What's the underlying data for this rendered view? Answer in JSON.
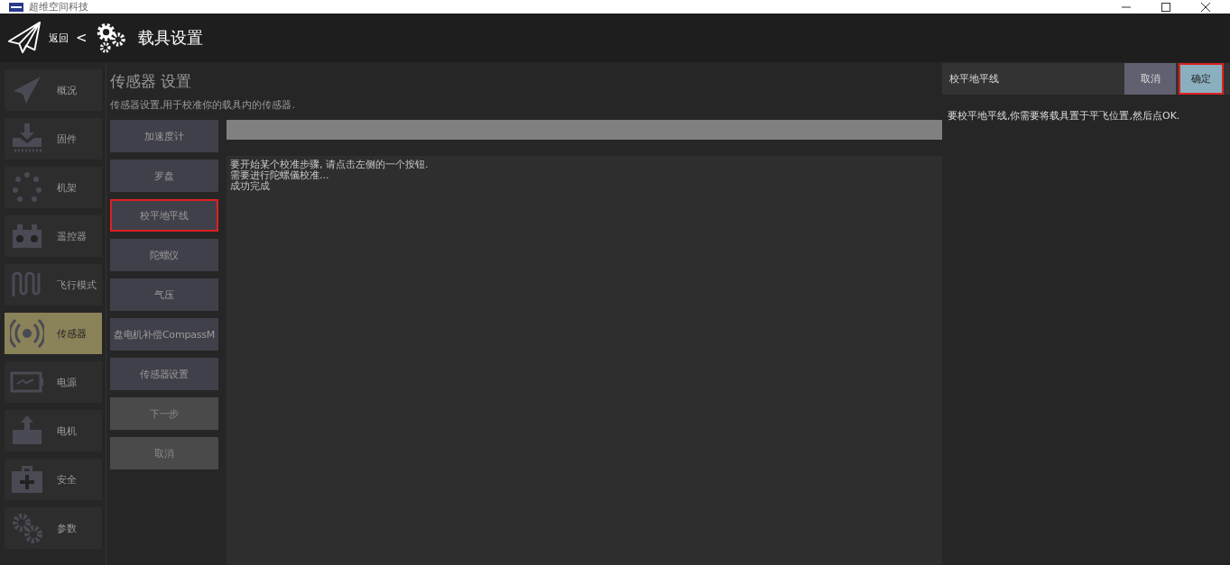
{
  "window": {
    "title": "超维空间科技"
  },
  "header": {
    "back": "返回",
    "separator": "<",
    "title": "载具设置"
  },
  "sidebar": {
    "items": [
      {
        "label": "概况",
        "selected": false
      },
      {
        "label": "固件",
        "selected": false
      },
      {
        "label": "机架",
        "selected": false
      },
      {
        "label": "遥控器",
        "selected": false
      },
      {
        "label": "飞行模式",
        "selected": false
      },
      {
        "label": "传感器",
        "selected": true
      },
      {
        "label": "电源",
        "selected": false
      },
      {
        "label": "电机",
        "selected": false
      },
      {
        "label": "安全",
        "selected": false
      },
      {
        "label": "参数",
        "selected": false
      }
    ]
  },
  "page": {
    "title": "传感器 设置",
    "description": "传感器设置,用于校准你的载具内的传感器."
  },
  "sensor_buttons": [
    {
      "label": "加速度计",
      "disabled": false,
      "highlighted": false
    },
    {
      "label": "罗盘",
      "disabled": false,
      "highlighted": false
    },
    {
      "label": "校平地平线",
      "disabled": false,
      "highlighted": true
    },
    {
      "label": "陀螺仪",
      "disabled": false,
      "highlighted": false
    },
    {
      "label": "气压",
      "disabled": false,
      "highlighted": false
    },
    {
      "label": "盘电机补偿CompassM",
      "disabled": false,
      "highlighted": false
    },
    {
      "label": "传感器设置",
      "disabled": false,
      "highlighted": false
    },
    {
      "label": "下一步",
      "disabled": true,
      "highlighted": false
    },
    {
      "label": "取消",
      "disabled": true,
      "highlighted": false
    }
  ],
  "progress": {
    "level": 0
  },
  "log": [
    "要开始某个校准步骤, 请点击左侧的一个按钮.",
    "需要进行陀螺儀校准...",
    "成功完成"
  ],
  "dialog": {
    "title": "校平地平线",
    "buttons": [
      {
        "label": "取消",
        "kind": "cancel",
        "highlighted": false
      },
      {
        "label": "确定",
        "kind": "ok",
        "highlighted": true
      }
    ],
    "message": "要校平地平线,你需要将载具置于平飞位置,然后点OK."
  }
}
